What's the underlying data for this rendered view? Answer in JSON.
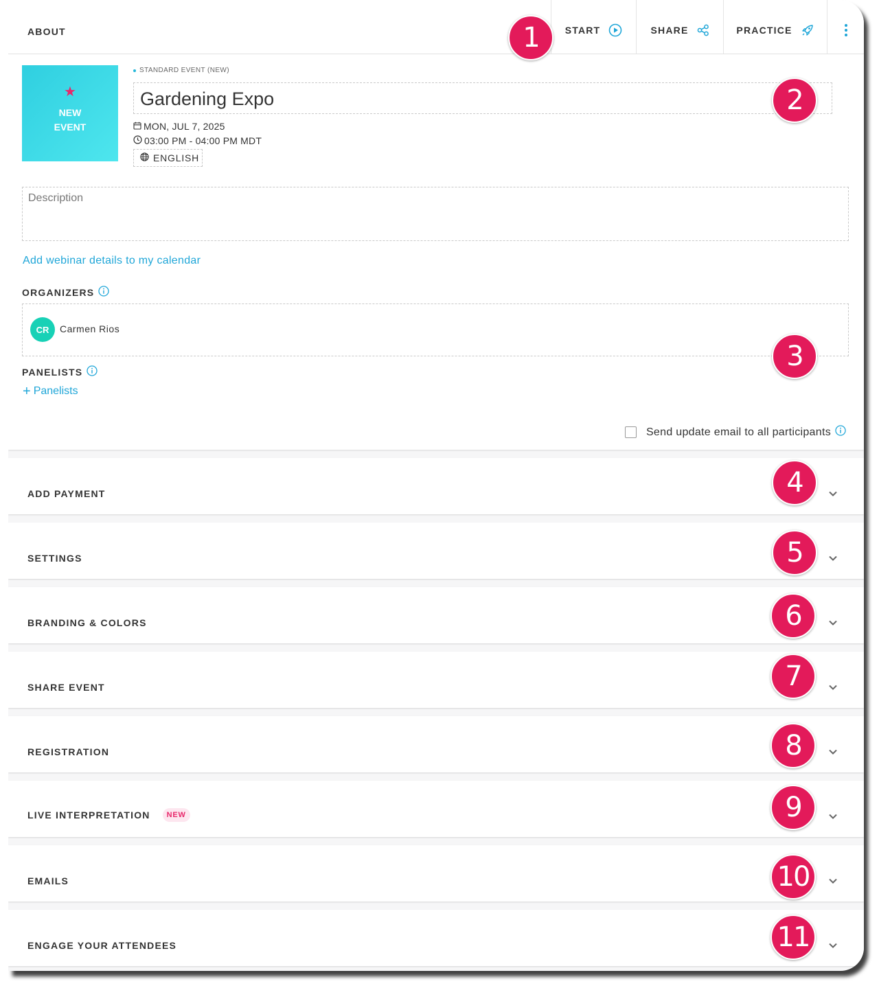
{
  "header": {
    "title": "ABOUT",
    "start_label": "START",
    "share_label": "SHARE",
    "practice_label": "PRACTICE"
  },
  "event": {
    "thumbnail_line1": "NEW",
    "thumbnail_line2": "EVENT",
    "type": "STANDARD EVENT (NEW)",
    "title": "Gardening Expo",
    "date": "MON, JUL 7, 2025",
    "time": "03:00 PM - 04:00 PM MDT",
    "language": "ENGLISH",
    "description_placeholder": "Description",
    "calendar_link": "Add webinar details to my calendar"
  },
  "organizers": {
    "label": "ORGANIZERS",
    "items": [
      {
        "initials": "CR",
        "name": "Carmen Rios"
      }
    ]
  },
  "panelists": {
    "label": "PANELISTS",
    "add_label": "Panelists"
  },
  "notify": {
    "label": "Send update email to all participants",
    "checked": false
  },
  "sections": [
    {
      "label": "ADD PAYMENT"
    },
    {
      "label": "SETTINGS"
    },
    {
      "label": "BRANDING & COLORS"
    },
    {
      "label": "SHARE EVENT"
    },
    {
      "label": "REGISTRATION"
    },
    {
      "label": "LIVE INTERPRETATION",
      "badge": "NEW"
    },
    {
      "label": "EMAILS"
    },
    {
      "label": "ENGAGE YOUR ATTENDEES"
    }
  ],
  "callouts": [
    "1",
    "2",
    "3",
    "4",
    "5",
    "6",
    "7",
    "8",
    "9",
    "10",
    "11"
  ],
  "colors": {
    "accent": "#1fa6d8",
    "callout": "#e31a5a",
    "avatar": "#18d1b6",
    "thumbnail": "#3dd9e8"
  }
}
